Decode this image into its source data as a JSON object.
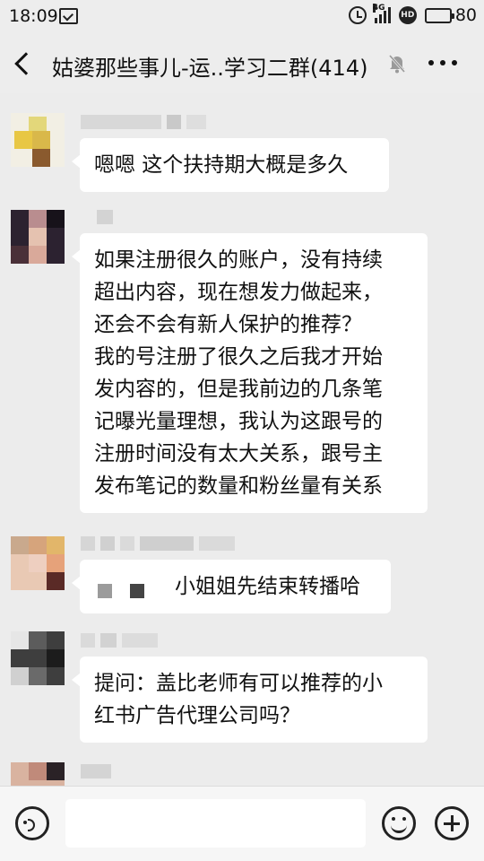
{
  "status_bar": {
    "time": "18:09",
    "network_label": "4G",
    "hd_label": "HD",
    "battery_percent": "80",
    "battery_level": 0.8
  },
  "header": {
    "title": "姑婆那些事儿-运..学习二群(414)",
    "back_icon": "chevron-left-icon",
    "mute_icon": "bell-off-icon",
    "more_icon": "more-dots-icon"
  },
  "messages": [
    {
      "lines": [
        "嗯嗯  这个扶持期大概是多久"
      ]
    },
    {
      "lines": [
        "如果注册很久的账户，没有持续",
        "超出内容，现在想发力做起来，",
        "还会不会有新人保护的推荐？",
        "我的号注册了很久之后我才开始",
        "发内容的，但是我前边的几条笔",
        "记曝光量理想，我认为这跟号的",
        "注册时间没有太大关系，跟号主",
        "发布笔记的数量和粉丝量有关系"
      ]
    },
    {
      "lines": [
        "小姐姐先结束转播哈"
      ]
    },
    {
      "lines": [
        "提问：盖比老师有可以推荐的小",
        "红书广告代理公司吗？"
      ]
    }
  ],
  "input_bar": {
    "placeholder": "",
    "voice_icon": "voice-icon",
    "emoji_icon": "emoji-icon",
    "plus_icon": "plus-icon"
  },
  "colors": {
    "background": "#ececec",
    "bubble": "#ffffff",
    "bar": "#ededed"
  }
}
